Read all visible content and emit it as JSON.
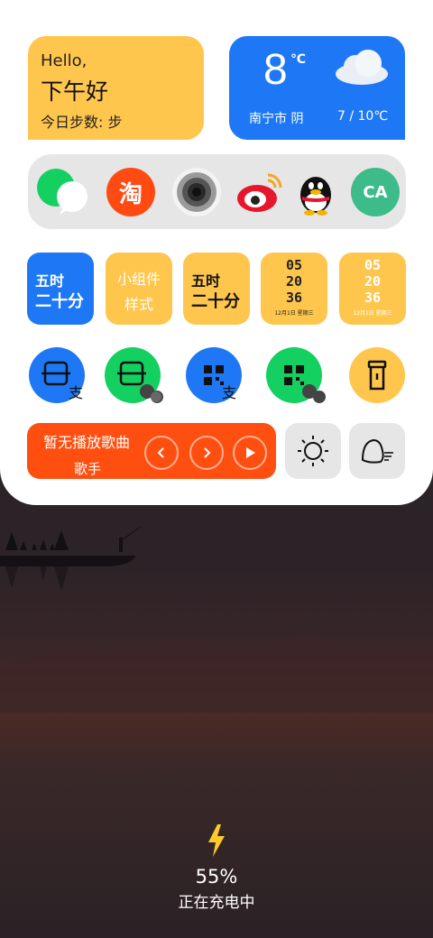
{
  "colors": {
    "yellow": "#ffc64d",
    "blue": "#1e78f5",
    "green": "#13d061",
    "orange": "#ff4f10",
    "grey": "#e6e6e6",
    "charge_bolt": "#ffc82c"
  },
  "greeting": {
    "hello": "Hello,",
    "period": "下午好",
    "steps": "今日步数: 步"
  },
  "weather": {
    "temp": "8",
    "unit": "℃",
    "city": "南宁市  阴",
    "range": "7 / 10℃",
    "icon": "cloud-icon"
  },
  "apps": [
    {
      "name": "wechat-icon"
    },
    {
      "name": "taobao-icon",
      "label": "淘"
    },
    {
      "name": "camera-icon"
    },
    {
      "name": "weibo-icon"
    },
    {
      "name": "qq-icon"
    },
    {
      "name": "maps-icon",
      "label": "CA"
    }
  ],
  "clock_tiles": [
    {
      "line1": "五时",
      "line2": "二十分"
    },
    {
      "line1": "小组件",
      "line2": "样式"
    },
    {
      "line1": "五时",
      "line2": "二十分"
    },
    {
      "h": "05",
      "m": "20",
      "s": "36",
      "date": "12月1日 星期三"
    },
    {
      "h": "05",
      "m": "20",
      "s": "36",
      "date": "12月1日 星期三"
    }
  ],
  "quick_actions": [
    "alipay-scan-icon",
    "wechat-scan-icon",
    "alipay-qr-icon",
    "wechat-qr-icon",
    "flashlight-icon"
  ],
  "music": {
    "title": "暂无播放歌曲",
    "artist": "歌手"
  },
  "controls": [
    "brightness-icon",
    "voice-assistant-icon"
  ],
  "charging": {
    "percent": "55%",
    "status": "正在充电中"
  }
}
